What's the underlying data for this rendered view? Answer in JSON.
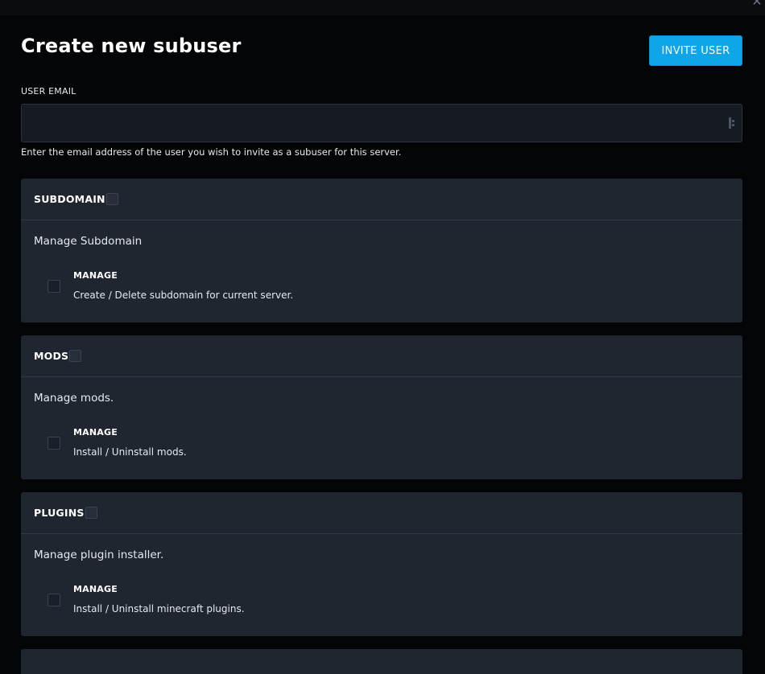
{
  "modal": {
    "title": "Create new subuser",
    "invite_button_label": "INVITE USER"
  },
  "email": {
    "label": "USER EMAIL",
    "value": "",
    "helper": "Enter the email address of the user you wish to invite as a subuser for this server."
  },
  "groups": [
    {
      "title": "SUBDOMAIN",
      "description": "Manage Subdomain",
      "permission": {
        "name": "MANAGE",
        "description": "Create / Delete subdomain for current server."
      }
    },
    {
      "title": "MODS",
      "description": "Manage mods.",
      "permission": {
        "name": "MANAGE",
        "description": "Install / Uninstall mods."
      }
    },
    {
      "title": "PLUGINS",
      "description": "Manage plugin installer.",
      "permission": {
        "name": "MANAGE",
        "description": "Install / Uninstall minecraft plugins."
      }
    }
  ],
  "colors": {
    "accent": "#0ea5e9",
    "card_bg": "#1f2630",
    "modal_bg": "#040506",
    "input_bg": "#161b22"
  },
  "icons": {
    "close": "close-icon",
    "password_manager": "password-manager-icon"
  }
}
